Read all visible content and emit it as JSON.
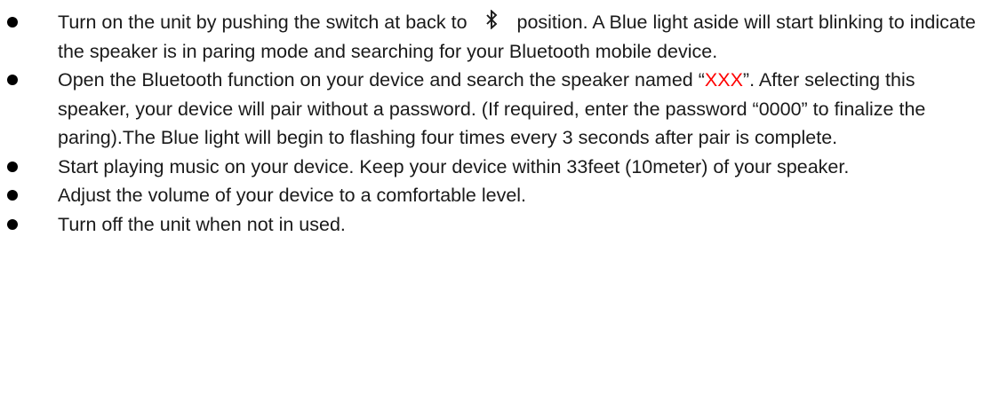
{
  "items": [
    {
      "before": "Turn on the unit by pushing the switch at back to ",
      "icon": "bluetooth-icon",
      "after": " position. A Blue light aside will start blinking to indicate the speaker is in paring mode and searching for your Bluetooth mobile device."
    },
    {
      "before": "Open the Bluetooth function on your device and search the speaker named “",
      "highlight": "XXX",
      "highlight_color": "#ff0000",
      "after": "”. After selecting this speaker, your device will pair without a password. (If required, enter the password “0000” to finalize the paring).The Blue light will begin to flashing four times every 3 seconds after pair is complete."
    },
    {
      "text": "Start playing music on your device. Keep your device within 33feet (10meter) of your speaker."
    },
    {
      "text": "Adjust the volume of your device to a comfortable level."
    },
    {
      "text": "Turn off the unit when not in used."
    }
  ]
}
